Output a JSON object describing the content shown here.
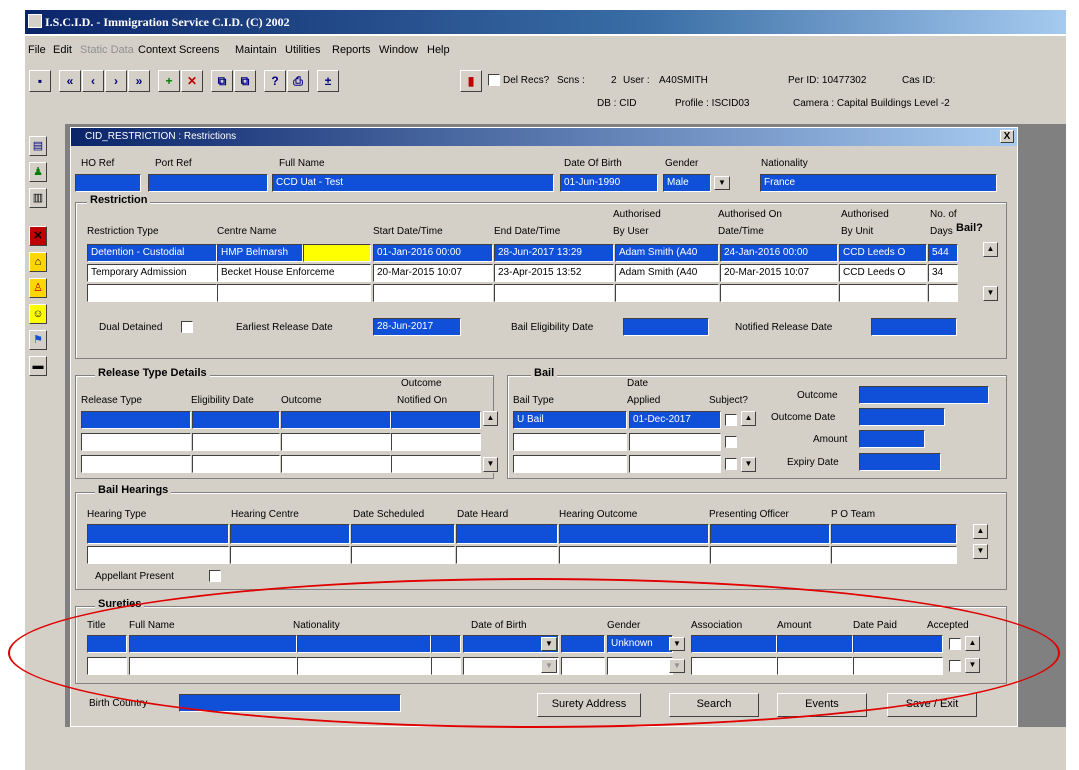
{
  "app": {
    "title": "I.S.C.I.D. - Immigration Service C.I.D. (C) 2002"
  },
  "menu": [
    "File",
    "Edit",
    "Static Data",
    "Context Screens",
    "Maintain",
    "Utilities",
    "Reports",
    "Window",
    "Help"
  ],
  "toolbar": {
    "del_recs": "Del Recs?",
    "scns": "Scns :",
    "scns_val": "2",
    "user_lbl": "User :",
    "user": "A40SMITH",
    "perid": "Per ID: 10477302",
    "casid": "Cas ID:",
    "db": "DB : CID",
    "profile": "Profile : ISCID03",
    "camera": "Camera : Capital Buildings Level -2"
  },
  "window": {
    "title": "CID_RESTRICTION : Restrictions",
    "close": "X"
  },
  "header": {
    "ho_ref": "HO Ref",
    "port_ref": "Port Ref",
    "full_name": "Full Name",
    "full_name_val": "CCD Uat - Test",
    "dob": "Date Of Birth",
    "dob_val": "01-Jun-1990",
    "gender": "Gender",
    "gender_val": "Male",
    "nationality": "Nationality",
    "nationality_val": "France"
  },
  "restriction": {
    "title": "Restriction",
    "cols": [
      "Restriction Type",
      "Centre Name",
      "Start Date/Time",
      "End Date/Time",
      "Authorised",
      "By User",
      "Authorised On",
      "Date/Time",
      "Authorised",
      "By Unit",
      "No. of",
      "Days",
      "Bail?"
    ],
    "rows": [
      [
        "Detention - Custodial",
        "HMP Belmarsh",
        "01-Jan-2016 00:00",
        "28-Jun-2017 13:29",
        "Adam Smith (A40",
        "24-Jan-2016 00:00",
        "CCD Leeds O",
        "544"
      ],
      [
        "Temporary Admission",
        "Becket House Enforceme",
        "20-Mar-2015 10:07",
        "23-Apr-2015 13:52",
        "Adam Smith (A40",
        "20-Mar-2015 10:07",
        "CCD Leeds O",
        "34"
      ]
    ],
    "dual_detained": "Dual Detained",
    "earliest_release": "Earliest Release Date",
    "earliest_release_val": "28-Jun-2017",
    "bail_elig": "Bail Eligibility Date",
    "notified_release": "Notified Release Date"
  },
  "release": {
    "title": "Release Type Details",
    "release_type": "Release Type",
    "elig_date": "Eligibility Date",
    "outcome": "Outcome",
    "outcome_notified1": "Outcome",
    "outcome_notified2": "Notified On"
  },
  "bail": {
    "title": "Bail",
    "bail_type": "Bail Type",
    "date1": "Date",
    "applied": "Applied",
    "subject": "Subject?",
    "row_type": "U Bail",
    "row_date": "01-Dec-2017",
    "outcome": "Outcome",
    "outcome_date": "Outcome Date",
    "amount": "Amount",
    "expiry": "Expiry Date"
  },
  "hearings": {
    "title": "Bail Hearings",
    "cols": [
      "Hearing Type",
      "Hearing Centre",
      "Date Scheduled",
      "Date Heard",
      "Hearing Outcome",
      "Presenting Officer",
      "P O Team"
    ],
    "appellant": "Appellant Present"
  },
  "sureties": {
    "title": "Sureties",
    "cols": [
      "Title",
      "Full Name",
      "Nationality",
      "Date of Birth",
      "Gender",
      "Association",
      "Amount",
      "Date Paid",
      "Accepted"
    ],
    "gender_val": "Unknown",
    "birth_country": "Birth Country"
  },
  "buttons": {
    "surety_address": "Surety Address",
    "search": "Search",
    "events": "Events",
    "save_exit": "Save / Exit"
  },
  "colors": {
    "field": "#1050d8",
    "highlight": "#ffff00",
    "annotation": "#e00000"
  }
}
